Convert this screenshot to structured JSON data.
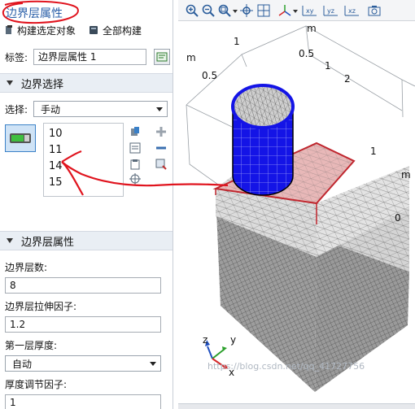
{
  "panel": {
    "title": "边界层属性",
    "toolbar": {
      "build_selected": "构建选定对象",
      "build_all": "全部构建"
    },
    "label_field": {
      "label": "标签:",
      "value": "边界层属性 1"
    },
    "boundary_selection": {
      "section_title": "边界选择",
      "select_label": "选择:",
      "select_value": "手动",
      "items": [
        "10",
        "11",
        "14",
        "15"
      ]
    },
    "layer_properties": {
      "section_title": "边界层属性",
      "num_layers_label": "边界层数:",
      "num_layers_value": "8",
      "stretch_label": "边界层拉伸因子:",
      "stretch_value": "1.2",
      "thickness_label": "第一层厚度:",
      "thickness_value": "自动",
      "adjust_label": "厚度调节因子:",
      "adjust_value": "1"
    }
  },
  "graphics": {
    "toolbar_icons": [
      "zoom-in-icon",
      "zoom-out-icon",
      "zoom-box-icon",
      "zoom-extents-icon",
      "grid-icon",
      "view-axis-icon",
      "xy-view-icon",
      "yz-view-icon",
      "xz-view-icon",
      "camera-icon"
    ],
    "view_buttons": [
      "xy",
      "yz",
      "xz"
    ],
    "axis_labels": {
      "m_left": "m",
      "m_top": "m",
      "m_right": "m",
      "v_05_left": "0.5",
      "v_1_top": "1",
      "v_05_top": "0.5",
      "v_1_right_top": "1",
      "v_2": "2",
      "v_1_right": "1",
      "v_0": "0"
    },
    "triad": {
      "z": "z",
      "y": "y",
      "x": "x"
    },
    "watermark": "https://blog.csdn.net/qq_41727756"
  },
  "colors": {
    "title_blue": "#2a5fa8",
    "annotation_red": "#e0141e",
    "highlight_blue": "#1414e6",
    "selected_red": "#c0262e"
  }
}
